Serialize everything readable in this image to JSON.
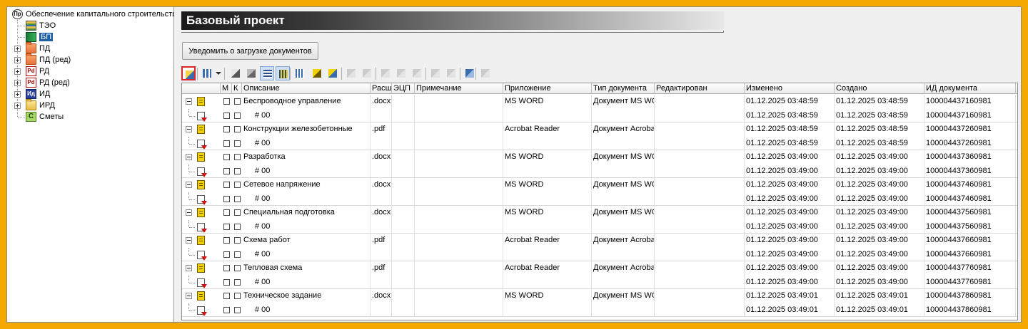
{
  "tree": {
    "root": "Обеспечение капитального строительства",
    "items": [
      {
        "label": "ТЭО",
        "icon": "stack-icon",
        "expandable": false,
        "selected": false
      },
      {
        "label": "БП",
        "icon": "book-icon",
        "expandable": false,
        "selected": true
      },
      {
        "label": "ПД",
        "icon": "folder-icon",
        "expandable": true,
        "selected": false
      },
      {
        "label": "ПД (ред)",
        "icon": "folder-icon",
        "expandable": true,
        "selected": false
      },
      {
        "label": "РД",
        "icon": "pdf-icon",
        "expandable": true,
        "selected": false
      },
      {
        "label": "РД (ред)",
        "icon": "pdf-icon",
        "expandable": true,
        "selected": false
      },
      {
        "label": "ИД",
        "icon": "id-icon",
        "expandable": true,
        "selected": false
      },
      {
        "label": "ИРД",
        "icon": "folder-open-icon",
        "expandable": true,
        "selected": false
      },
      {
        "label": "Сметы",
        "icon": "estimate-icon",
        "expandable": false,
        "selected": false
      }
    ]
  },
  "panel": {
    "title": "Базовый проект",
    "notify_button": "Уведомить о загрузке документов"
  },
  "icon_glyphs": {
    "root": "Пр",
    "pdf": "Pd",
    "id": "Ид",
    "estimate": "C"
  },
  "grid": {
    "columns": {
      "m": "М",
      "k": "К",
      "description": "Описание",
      "extension": "Расш",
      "eds": "ЭЦП",
      "note": "Примечание",
      "application": "Приложение",
      "doc_type": "Тип документа",
      "edited": "Редактирован",
      "modified": "Изменено",
      "created": "Создано",
      "doc_id": "ИД документа"
    },
    "version_label": "# 00",
    "documents": [
      {
        "name": "Беспроводное управление",
        "ext": ".docx",
        "app": "MS WORD",
        "type": "Документ MS WO",
        "modified": "01.12.2025 03:48:59",
        "created": "01.12.2025 03:48:59",
        "id": "100004437160981"
      },
      {
        "name": "Конструкции железобетонные",
        "ext": ".pdf",
        "app": "Acrobat Reader",
        "type": "Документ Acroba",
        "modified": "01.12.2025 03:48:59",
        "created": "01.12.2025 03:48:59",
        "id": "100004437260981"
      },
      {
        "name": "Разработка",
        "ext": ".docx",
        "app": "MS WORD",
        "type": "Документ MS WO",
        "modified": "01.12.2025 03:49:00",
        "created": "01.12.2025 03:49:00",
        "id": "100004437360981"
      },
      {
        "name": "Сетевое напряжение",
        "ext": ".docx",
        "app": "MS WORD",
        "type": "Документ MS WO",
        "modified": "01.12.2025 03:49:00",
        "created": "01.12.2025 03:49:00",
        "id": "100004437460981"
      },
      {
        "name": "Специальная подготовка",
        "ext": ".docx",
        "app": "MS WORD",
        "type": "Документ MS WO",
        "modified": "01.12.2025 03:49:00",
        "created": "01.12.2025 03:49:00",
        "id": "100004437560981"
      },
      {
        "name": "Схема работ",
        "ext": ".pdf",
        "app": "Acrobat Reader",
        "type": "Документ Acroba",
        "modified": "01.12.2025 03:49:00",
        "created": "01.12.2025 03:49:00",
        "id": "100004437660981"
      },
      {
        "name": "Тепловая схема",
        "ext": ".pdf",
        "app": "Acrobat Reader",
        "type": "Документ Acroba",
        "modified": "01.12.2025 03:49:00",
        "created": "01.12.2025 03:49:00",
        "id": "100004437760981"
      },
      {
        "name": "Техническое задание",
        "ext": ".docx",
        "app": "MS WORD",
        "type": "Документ MS WO",
        "modified": "01.12.2025 03:49:01",
        "created": "01.12.2025 03:49:01",
        "id": "100004437860981"
      }
    ]
  },
  "colors": {
    "frame": "#f5a800",
    "selection": "#1f5fa8",
    "highlight_border": "#d8282c"
  }
}
